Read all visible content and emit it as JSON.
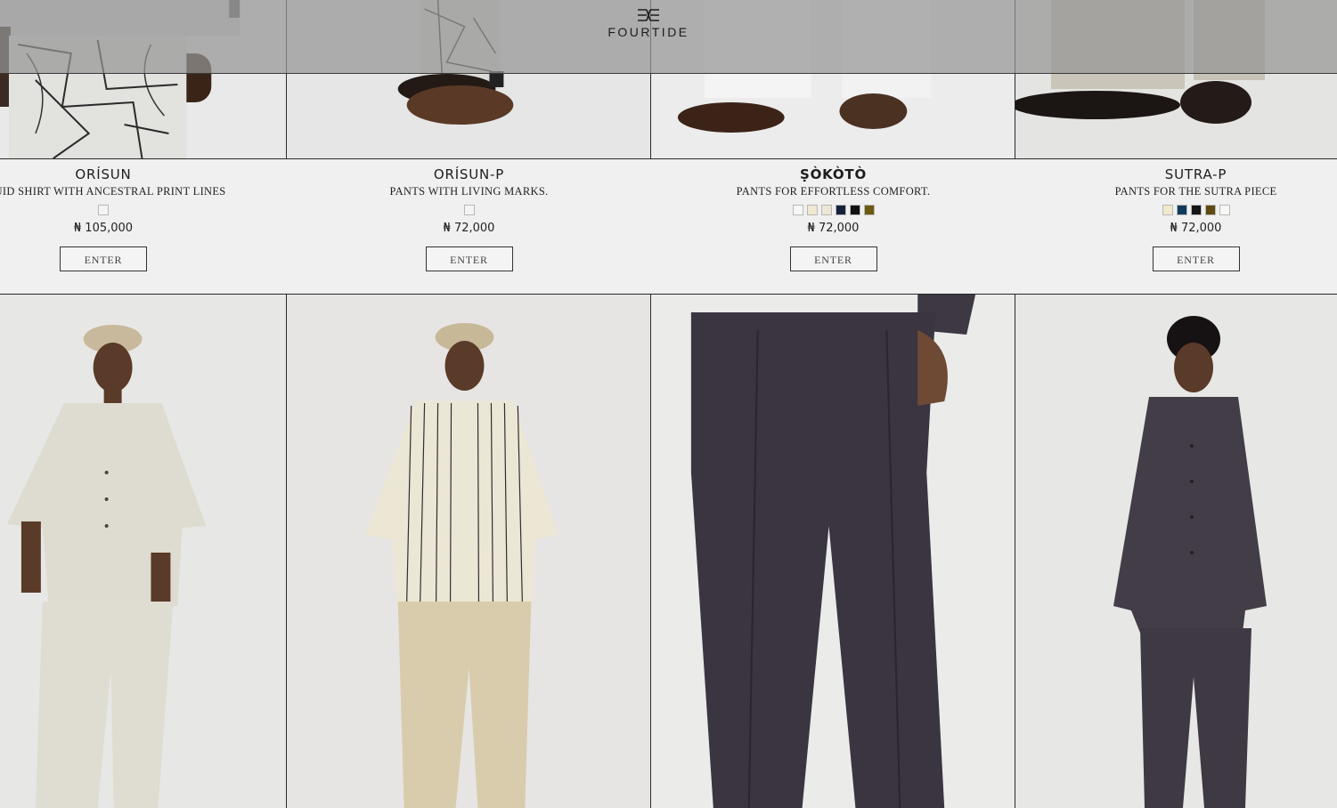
{
  "brand": {
    "name": "FOURTIDE",
    "logo_icon": "fourtide-logo-icon"
  },
  "products": [
    {
      "name": "ORÍSUN",
      "description": "FLUID SHIRT WITH ANCESTRAL PRINT LINES",
      "swatches": [
        "#f4f4f2"
      ],
      "price": "₦ 105,000",
      "cta": "ENTER",
      "bold": false
    },
    {
      "name": "ORÍSUN-P",
      "description": "PANTS WITH LIVING MARKS.",
      "swatches": [
        "#f4f4f2"
      ],
      "price": "₦ 72,000",
      "cta": "ENTER",
      "bold": false
    },
    {
      "name": "ṢÒKÒTÒ",
      "description": "PANTS FOR EFFORTLESS COMFORT.",
      "swatches": [
        "#f7f7f5",
        "#efe9d2",
        "#ede5d6",
        "#14213d",
        "#111111",
        "#6b5a12"
      ],
      "price": "₦ 72,000",
      "cta": "ENTER",
      "bold": true
    },
    {
      "name": "SUTRA-P",
      "description": "PANTS FOR THE SUTRA PIECE",
      "swatches": [
        "#efeacc",
        "#0f3a5c",
        "#151515",
        "#5e4a10",
        "#f7f7f5"
      ],
      "price": "₦ 72,000",
      "cta": "ENTER",
      "bold": false
    }
  ],
  "bottom_images": [
    {
      "alt_icon": "model-cream-shirt-image"
    },
    {
      "alt_icon": "model-striped-shirt-image"
    },
    {
      "alt_icon": "charcoal-pants-image"
    },
    {
      "alt_icon": "model-charcoal-set-image"
    }
  ]
}
